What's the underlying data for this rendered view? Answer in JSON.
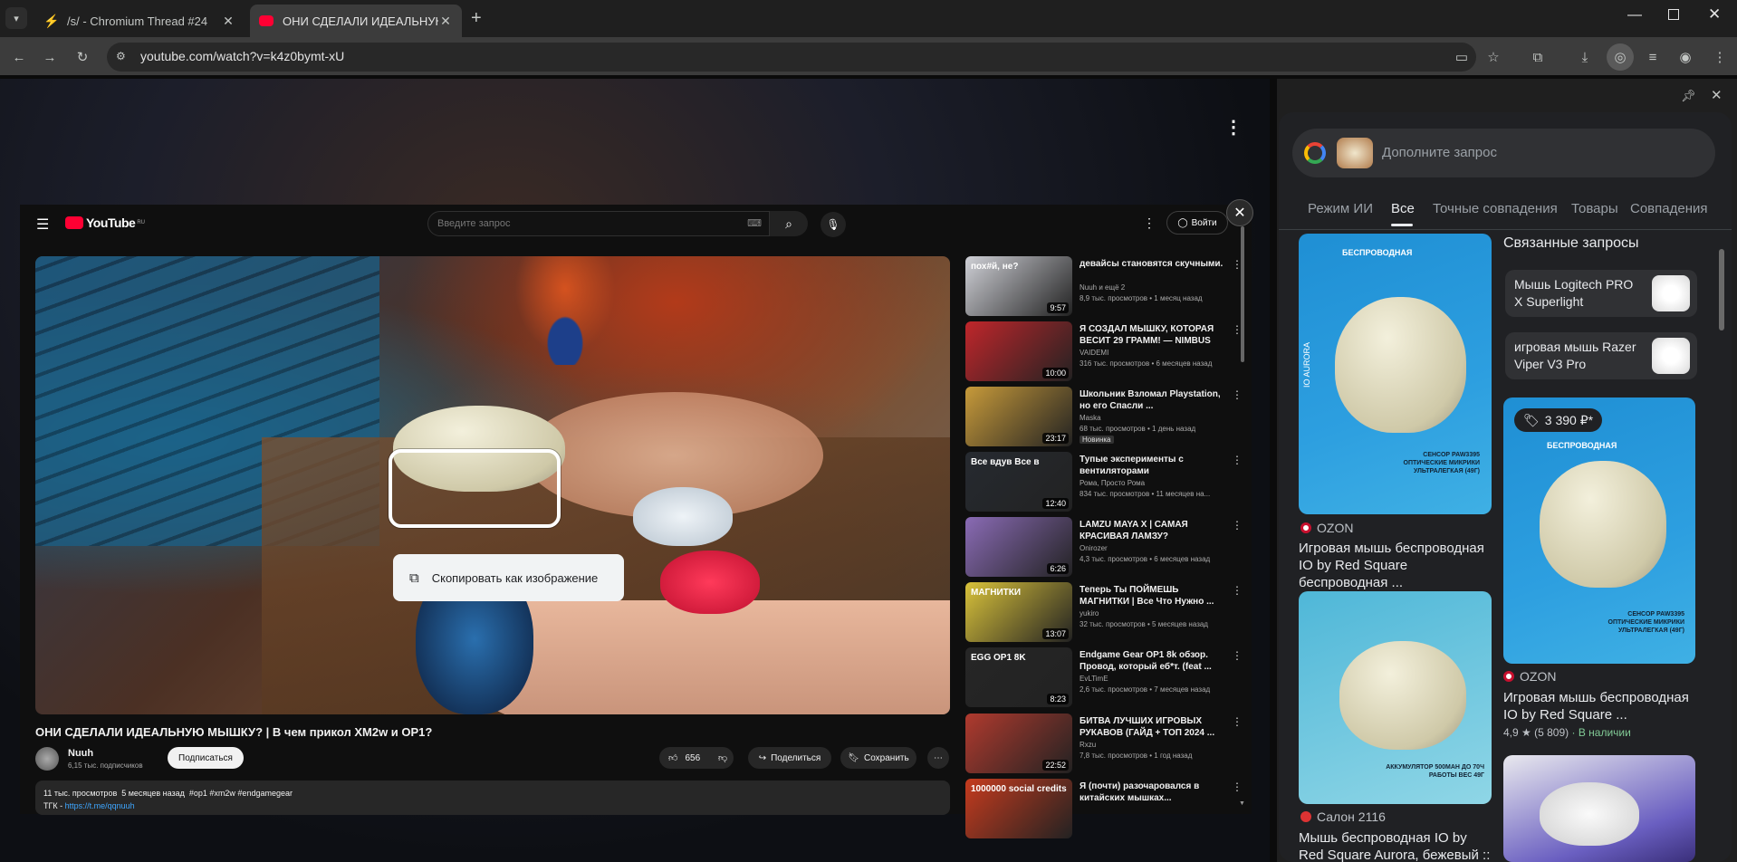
{
  "tabs": [
    {
      "title": "/s/ - Chromium Thread #24"
    },
    {
      "title": "ОНИ СДЕЛАЛИ ИДЕАЛЬНУЮ"
    }
  ],
  "address": {
    "url": "youtube.com/watch?v=k4z0bymt-xU"
  },
  "youtube": {
    "logo": "YouTube",
    "region": "RU",
    "search_placeholder": "Введите запрос",
    "login": "Войти",
    "title": "ОНИ СДЕЛАЛИ ИДЕАЛЬНУЮ МЫШКУ? | В чем прикол XM2w и OP1?",
    "channel": "Nuuh",
    "subs": "6,15 тыс. подписчиков",
    "subscribe": "Подписаться",
    "likes": "656",
    "share": "Поделиться",
    "save": "Сохранить",
    "desc_line1": "11 тыс. просмотров  5 месяцев назад  #op1 #xm2w #endgamegear",
    "desc_prefix": "ТГК - ",
    "desc_link": "https://t.me/qqnuuh",
    "lens_copy": "Скопировать как изображение"
  },
  "related": [
    {
      "title": "девайсы становятся скучными.",
      "channel": "Nuuh и ещё 2",
      "meta": "8,9 тыс. просмотров • 1 месяц назад",
      "dur": "9:57",
      "thumb_text": "пох#й, не?",
      "color": "#cfd0d6"
    },
    {
      "title": "Я СОЗДАЛ МЫШКУ, КОТОРАЯ ВЕСИТ 29 ГРАММ! — NIMBUS",
      "channel": "VAIDEMI",
      "meta": "316 тыс. просмотров • 6 месяцев назад",
      "dur": "10:00",
      "thumb_text": "",
      "color": "#c0262b"
    },
    {
      "title": "Школьник Взломал Playstation, но его Спасли ...",
      "channel": "Maska",
      "meta": "68 тыс. просмотров • 1 день назад",
      "badge": "Новинка",
      "dur": "23:17",
      "thumb_text": "",
      "color": "#c79a3a"
    },
    {
      "title": "Тупые эксперименты с вентиляторами",
      "channel": "Рома, Просто Рома",
      "meta": "834 тыс. просмотров • 11 месяцев на...",
      "dur": "12:40",
      "thumb_text": "Все вдув   Все в",
      "color": "#262a30"
    },
    {
      "title": "LAMZU MAYA X | САМАЯ КРАСИВАЯ ЛАМЗУ?",
      "channel": "Onirozer",
      "meta": "4,3 тыс. просмотров • 6 месяцев назад",
      "dur": "6:26",
      "thumb_text": "",
      "color": "#8a6bb5"
    },
    {
      "title": "Теперь Ты ПОЙМЕШЬ МАГНИТКИ | Все Что Нужно ...",
      "channel": "yukiro",
      "meta": "32 тыс. просмотров • 5 месяцев назад",
      "dur": "13:07",
      "thumb_text": "МАГНИТКИ",
      "color": "#d9c23a"
    },
    {
      "title": "Endgame Gear OP1 8k обзор. Провод, который еб*т. (feat ...",
      "channel": "EvLTimE",
      "meta": "2,6 тыс. просмотров • 7 месяцев назад",
      "dur": "8:23",
      "thumb_text": "EGG OP1 8K",
      "color": "#262626"
    },
    {
      "title": "БИТВА ЛУЧШИХ ИГРОВЫХ РУКАВОВ (ГАЙД + ТОП 2024 ...",
      "channel": "Rxzu",
      "meta": "7,8 тыс. просмотров • 1 год назад",
      "dur": "22:52",
      "thumb_text": "",
      "color": "#b03a2e"
    },
    {
      "title": "Я (почти) разочаровался в китайских мышках...",
      "channel": "",
      "meta": "",
      "dur": "",
      "thumb_text": "1000000 social credits",
      "color": "#c63b1e"
    }
  ],
  "lens": {
    "query_placeholder": "Дополните запрос",
    "tabs": [
      "Режим ИИ",
      "Все",
      "Точные совпадения",
      "Товары",
      "Совпадения"
    ],
    "related_heading": "Связанные запросы",
    "related": [
      {
        "label": "Мышь Logitech PRO X Superlight"
      },
      {
        "label": "игровая мышь Razer Viper V3 Pro"
      }
    ],
    "price": "3 390 ₽*",
    "results": [
      {
        "source": "OZON",
        "title": "Игровая мышь беспроводная IO by Red Square беспроводная ...",
        "card_top": "БЕСПРОВОДНАЯ",
        "card_side": "IO AURORA",
        "card_bottom": "СЕНСОР PAW3395 ОПТИЧЕСКИЕ МИКРИКИ УЛЬТРАЛЕГКАЯ (49Г)"
      },
      {
        "source": "OZON",
        "title": "Игровая мышь беспроводная IO by Red Square ...",
        "rating": "4,9 ★ (5 809)",
        "stock": "· В наличии",
        "card_top": "БЕСПРОВОДНАЯ",
        "card_bottom": "СЕНСОР PAW3395 ОПТИЧЕСКИЕ МИКРИКИ УЛЬТРАЛЕГКАЯ (49Г)"
      },
      {
        "source": "Салон 2116",
        "title": "Мышь беспроводная IO by Red Square Aurora, бежевый :: Сал...",
        "card_bottom": "АККУМУЛЯТОР 500MAH ДО 70Ч РАБОТЫ ВЕС 49Г"
      }
    ]
  }
}
